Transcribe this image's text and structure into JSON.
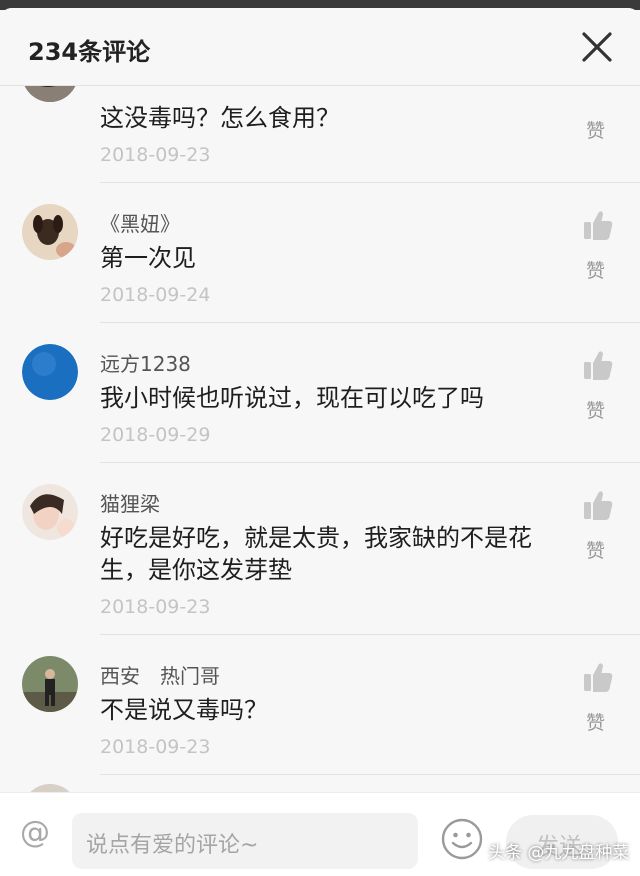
{
  "header": {
    "title": "234条评论"
  },
  "comments": [
    {
      "user": "",
      "text": "这没毒吗？怎么食用？",
      "date": "2018-09-23",
      "like_label": "赞"
    },
    {
      "user": "《黑妞》",
      "text": "第一次见",
      "date": "2018-09-24",
      "like_label": "赞"
    },
    {
      "user": "远方1238",
      "text": "我小时候也听说过，现在可以吃了吗",
      "date": "2018-09-29",
      "like_label": "赞"
    },
    {
      "user": "猫狸梁",
      "text": "好吃是好吃，就是太贵，我家缺的不是花生，是你这发芽垫",
      "date": "2018-09-23",
      "like_label": "赞"
    },
    {
      "user": "西安　热门哥",
      "text": "不是说又毒吗？",
      "date": "2018-09-23",
      "like_label": "赞"
    }
  ],
  "composer": {
    "at_symbol": "@",
    "placeholder": "说点有爱的评论~",
    "send_label": "发送"
  },
  "watermark": "头条 @九九盘种菜",
  "icons": {
    "close": "close-icon",
    "like": "thumbs-up-icon",
    "emoji": "smiley-icon"
  },
  "colors": {
    "background": "#f7f7f7",
    "date_text": "#c4c4c4",
    "username_text": "#555555",
    "avatar_blue": "#1a6fc0"
  }
}
